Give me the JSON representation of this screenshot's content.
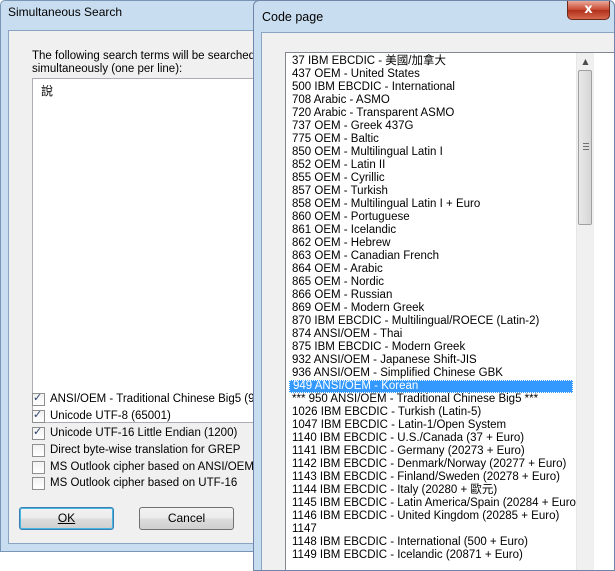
{
  "search_window": {
    "title": "Simultaneous Search",
    "description": "The following search terms will be searched simultaneously (one per line):",
    "search_terms": "說",
    "options": [
      {
        "label": "ANSI/OEM - Traditional Chinese Big5 (950)",
        "checked": true
      },
      {
        "label": "Unicode UTF-8 (65001)",
        "checked": true
      },
      {
        "label": "Unicode UTF-16 Little Endian (1200)",
        "checked": true
      },
      {
        "label": "Direct byte-wise translation for GREP",
        "checked": false
      },
      {
        "label": "MS Outlook cipher based on ANSI/OEM - Tr",
        "checked": false
      },
      {
        "label": "MS Outlook cipher based on UTF-16",
        "checked": false
      }
    ],
    "ok_label": "OK",
    "cancel_label": "Cancel"
  },
  "codepage_window": {
    "title": "Code page",
    "close_glyph": "x",
    "selected_index": 25,
    "items": [
      "37  IBM EBCDIC - 美國/加拿大",
      "437  OEM - United States",
      "500  IBM EBCDIC - International",
      "708  Arabic - ASMO",
      "720  Arabic - Transparent ASMO",
      "737  OEM - Greek 437G",
      "775  OEM - Baltic",
      "850  OEM - Multilingual Latin I",
      "852  OEM - Latin II",
      "855  OEM - Cyrillic",
      "857  OEM - Turkish",
      "858  OEM - Multilingual Latin I + Euro",
      "860  OEM - Portuguese",
      "861  OEM - Icelandic",
      "862  OEM - Hebrew",
      "863  OEM - Canadian French",
      "864  OEM - Arabic",
      "865  OEM - Nordic",
      "866  OEM - Russian",
      "869  OEM - Modern Greek",
      "870  IBM EBCDIC - Multilingual/ROECE (Latin-2)",
      "874  ANSI/OEM - Thai",
      "875  IBM EBCDIC - Modern Greek",
      "932  ANSI/OEM - Japanese Shift-JIS",
      "936  ANSI/OEM - Simplified Chinese GBK",
      "949  ANSI/OEM - Korean",
      "*** 950  ANSI/OEM - Traditional Chinese Big5 ***",
      "1026  IBM EBCDIC - Turkish (Latin-5)",
      "1047  IBM EBCDIC - Latin-1/Open System",
      "1140  IBM EBCDIC - U.S./Canada (37 + Euro)",
      "1141  IBM EBCDIC - Germany (20273 + Euro)",
      "1142  IBM EBCDIC - Denmark/Norway (20277 + Euro)",
      "1143  IBM EBCDIC - Finland/Sweden (20278 + Euro)",
      "1144  IBM EBCDIC - Italy (20280 + 歐元)",
      "1145  IBM EBCDIC - Latin America/Spain (20284 + Euro)",
      "1146  IBM EBCDIC - United Kingdom (20285 + Euro)",
      "1147",
      "1148  IBM EBCDIC - International (500 + Euro)",
      "1149  IBM EBCDIC - Icelandic (20871 + Euro)"
    ],
    "scroll_up_glyph": "▲"
  },
  "colors": {
    "selection": "#3399ff",
    "frame": "#c9ddf0"
  }
}
